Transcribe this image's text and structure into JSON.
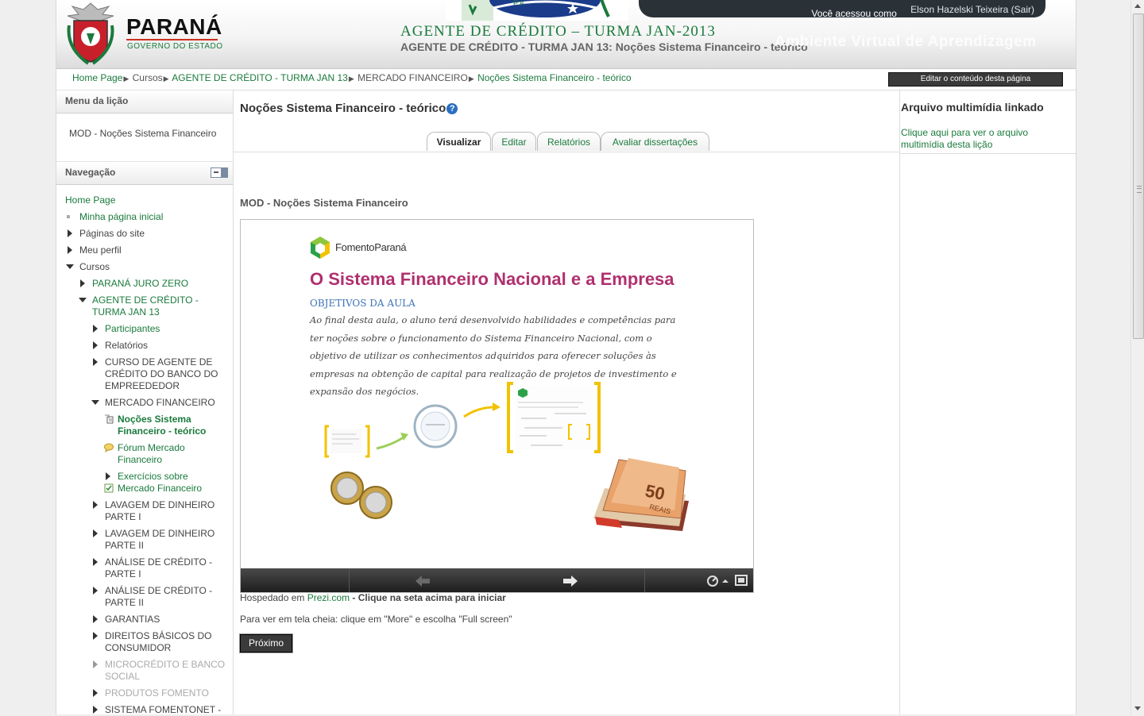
{
  "header": {
    "parana": "PARANÁ",
    "governo": "GOVERNO DO ESTADO",
    "user_prefix": "Você acessou como ",
    "user_name": "Elson Hazelski Teixeira",
    "logout": "(Sair)",
    "course_title": "AGENTE DE CRÉDITO – TURMA JAN-2013",
    "course_subtitle": "AGENTE DE CRÉDITO - TURMA JAN 13: Noções Sistema Financeiro - teórico",
    "ava": "Ambiente Virtual de Aprendizagem"
  },
  "breadcrumb": {
    "items": [
      "Home Page",
      "Cursos",
      "AGENTE DE CRÉDITO - TURMA JAN 13",
      "MERCADO FINANCEIRO",
      "Noções Sistema Financeiro - teórico"
    ],
    "edit_button": "Editar o conteúdo desta página"
  },
  "lesson_menu": {
    "header": "Menu da lição",
    "link": "MOD - Noções Sistema Financeiro"
  },
  "navigation": {
    "header": "Navegação",
    "items": [
      {
        "label": "Home Page"
      },
      {
        "label": "Minha página inicial"
      },
      {
        "label": "Páginas do site"
      },
      {
        "label": "Meu perfil"
      },
      {
        "label": "Cursos"
      },
      {
        "label": "PARANÁ JURO ZERO"
      },
      {
        "label": "AGENTE DE CRÉDITO - TURMA JAN 13"
      },
      {
        "label": "Participantes"
      },
      {
        "label": "Relatórios"
      },
      {
        "label": "CURSO DE AGENTE DE CRÉDITO DO BANCO DO EMPREEDEDOR"
      },
      {
        "label": "MERCADO FINANCEIRO"
      },
      {
        "label": "Noções Sistema Financeiro - teórico"
      },
      {
        "label": "Fórum Mercado Financeiro"
      },
      {
        "label": "Exercícios sobre Mercado Financeiro"
      },
      {
        "label": "LAVAGEM DE DINHEIRO PARTE I"
      },
      {
        "label": "LAVAGEM DE DINHEIRO PARTE II"
      },
      {
        "label": "ANÁLISE DE CRÉDITO - PARTE I"
      },
      {
        "label": "ANÁLISE DE CRÉDITO - PARTE II"
      },
      {
        "label": "GARANTIAS"
      },
      {
        "label": "DIREITOS BÁSICOS DO CONSUMIDOR"
      },
      {
        "label": "MICROCRÉDITO E BANCO SOCIAL"
      },
      {
        "label": "PRODUTOS FOMENTO"
      },
      {
        "label": "SISTEMA FOMENTONET -"
      }
    ]
  },
  "main": {
    "title": "Noções Sistema Financeiro - teórico",
    "tabs": [
      "Visualizar",
      "Editar",
      "Relatórios",
      "Avaliar dissertações"
    ],
    "module_title": "MOD - Noções Sistema Financeiro",
    "slide": {
      "brand": "FomentoParaná",
      "title": "O Sistema Financeiro Nacional e a Empresa",
      "objectives_title": "OBJETIVOS DA AULA",
      "objectives_text": "Ao final desta aula, o aluno terá desenvolvido habilidades e competências para ter noções sobre o funcionamento do Sistema Financeiro Nacional, com o objetivo de utilizar os conhecimentos adquiridos para oferecer soluções às empresas na obtenção de capital para realização de projetos de investimento e expansão dos negócios.",
      "banknote": "50 REAIS"
    },
    "hosted_prefix": "Hospedado em ",
    "hosted_link": "Prezi.com",
    "hosted_suffix": " - Clique na seta acima para iniciar",
    "fullscreen_note": "Para ver em tela cheia: clique em \"More\" e escolha \"Full screen\"",
    "next_button": "Próximo"
  },
  "right": {
    "header": "Arquivo multimídia linkado",
    "link": "Clique aqui para ver o arquivo multimídia desta lição"
  },
  "colors": {
    "link_green": "#1a7a3c",
    "slide_title": "#b0306e",
    "dark_button": "#3a3a3a"
  }
}
